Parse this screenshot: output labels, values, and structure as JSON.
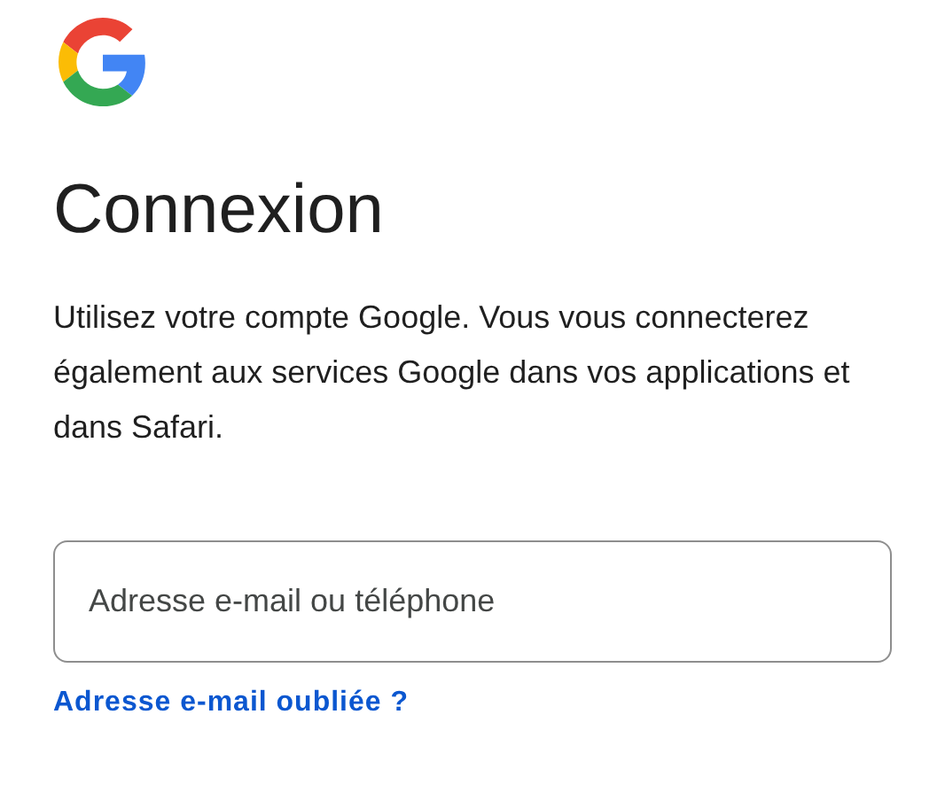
{
  "title": "Connexion",
  "description": "Utilisez votre compte Google. Vous vous connecterez également aux services Google dans vos applications et dans Safari.",
  "email_field": {
    "placeholder": "Adresse e-mail ou téléphone"
  },
  "forgot_link": "Adresse e-mail oubliée ?"
}
